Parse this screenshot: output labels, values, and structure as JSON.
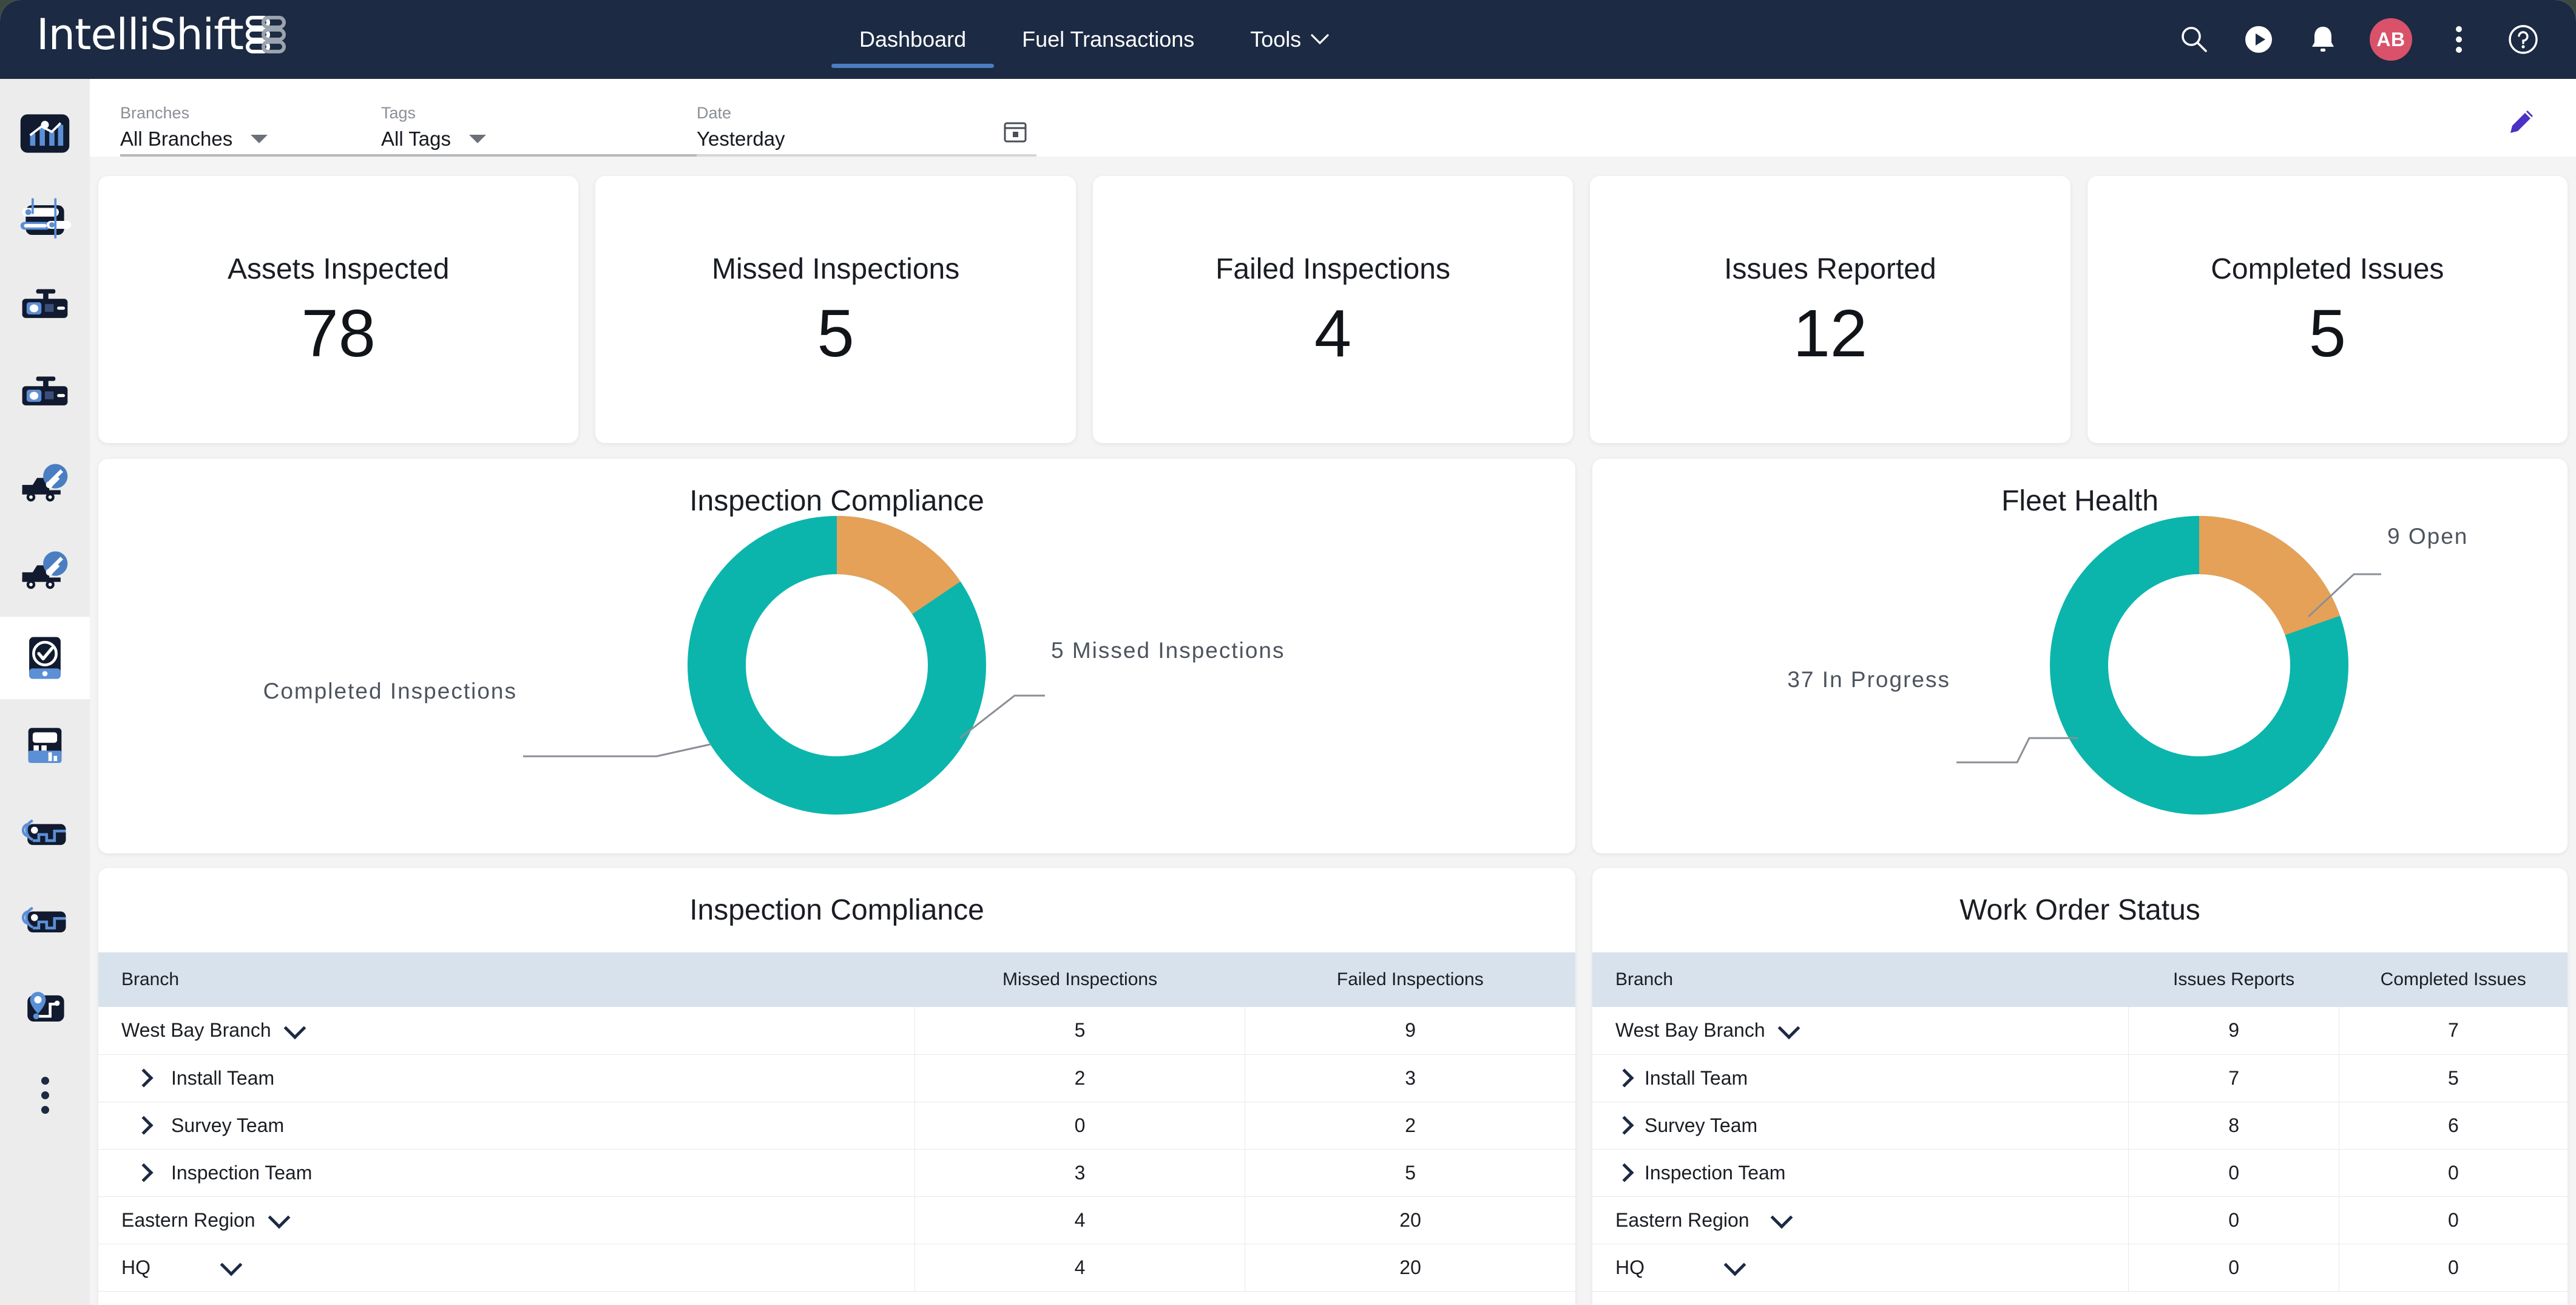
{
  "brand": {
    "name": "IntelliShift",
    "logo_icon": "intellishift-logo"
  },
  "topnav": {
    "items": [
      {
        "label": "Dashboard",
        "active": true
      },
      {
        "label": "Fuel Transactions",
        "active": false
      },
      {
        "label": "Tools",
        "active": false,
        "caret": true
      }
    ],
    "actions": [
      {
        "name": "search-icon"
      },
      {
        "name": "play-circle-icon"
      },
      {
        "name": "bell-icon"
      },
      {
        "name": "avatar",
        "initials": "AB"
      },
      {
        "name": "kebab-menu-icon"
      },
      {
        "name": "help-icon"
      }
    ],
    "avatar_initials": "AB",
    "avatar_color": "#d9526a",
    "active_underline_color": "#4a7ec0",
    "background": "#1c2a43"
  },
  "sidebar": {
    "items": [
      {
        "name": "sidebar-item-dashboard",
        "icon": "chart-dashboard-icon",
        "active": false
      },
      {
        "name": "sidebar-item-asset-tracking",
        "icon": "asset-tracking-icon",
        "active": false
      },
      {
        "name": "sidebar-item-dashcam",
        "icon": "dashcam-icon",
        "active": false
      },
      {
        "name": "sidebar-item-dashcam-2",
        "icon": "dashcam-icon",
        "active": false
      },
      {
        "name": "sidebar-item-maintenance",
        "icon": "truck-wrench-icon",
        "active": false
      },
      {
        "name": "sidebar-item-maintenance-2",
        "icon": "truck-wrench-icon",
        "active": false
      },
      {
        "name": "sidebar-item-inspections",
        "icon": "inspection-check-icon",
        "active": true
      },
      {
        "name": "sidebar-item-reports",
        "icon": "report-card-icon",
        "active": false
      },
      {
        "name": "sidebar-item-routes",
        "icon": "route-signal-icon",
        "active": false
      },
      {
        "name": "sidebar-item-routes-2",
        "icon": "route-signal-icon",
        "active": false
      },
      {
        "name": "sidebar-item-map",
        "icon": "map-pin-route-icon",
        "active": false
      },
      {
        "name": "sidebar-item-more",
        "icon": "kebab-menu-icon",
        "active": false
      }
    ]
  },
  "filters": {
    "branches": {
      "label": "Branches",
      "value": "All Branches"
    },
    "tags": {
      "label": "Tags",
      "value": "All Tags"
    },
    "date": {
      "label": "Date",
      "value": "Yesterday",
      "icon": "calendar-icon"
    },
    "edit": {
      "icon": "pencil-icon",
      "color": "#4b31c4"
    }
  },
  "kpis": [
    {
      "title": "Assets Inspected",
      "value": "78"
    },
    {
      "title": "Missed Inspections",
      "value": "5"
    },
    {
      "title": "Failed Inspections",
      "value": "4"
    },
    {
      "title": "Issues Reported",
      "value": "12"
    },
    {
      "title": "Completed Issues",
      "value": "5"
    }
  ],
  "chart_data": [
    {
      "type": "pie",
      "title": "Inspection Compliance",
      "variant": "donut",
      "labels": [
        "Completed Inspections",
        "5 Missed Inspections"
      ],
      "values": [
        73,
        13
      ],
      "colors": [
        "#0bb5ac",
        "#e5a158"
      ],
      "annotations": [
        {
          "text": "Completed Inspections",
          "side": "left"
        },
        {
          "text": "5 Missed Inspections",
          "side": "right"
        }
      ],
      "legend": "callout-labels"
    },
    {
      "type": "pie",
      "title": "Fleet Health",
      "variant": "donut",
      "labels": [
        "37 In Progress",
        "9 Open"
      ],
      "values": [
        37,
        9
      ],
      "colors": [
        "#0bb5ac",
        "#e5a158"
      ],
      "annotations": [
        {
          "text": "37 In Progress",
          "side": "left"
        },
        {
          "text": "9 Open",
          "side": "right"
        }
      ],
      "legend": "callout-labels"
    }
  ],
  "tables": {
    "inspection_compliance": {
      "title": "Inspection Compliance",
      "columns": [
        "Branch",
        "Missed Inspections",
        "Failed Inspections"
      ],
      "rows": [
        {
          "branch": "West Bay Branch",
          "level": 0,
          "toggle": "down",
          "missed": "5",
          "failed": "9"
        },
        {
          "branch": "Install Team",
          "level": 1,
          "toggle": "right",
          "missed": "2",
          "failed": "3"
        },
        {
          "branch": "Survey Team",
          "level": 1,
          "toggle": "right",
          "missed": "0",
          "failed": "2"
        },
        {
          "branch": "Inspection Team",
          "level": 1,
          "toggle": "right",
          "missed": "3",
          "failed": "5"
        },
        {
          "branch": "Eastern Region",
          "level": 0,
          "toggle": "down",
          "missed": "4",
          "failed": "20"
        },
        {
          "branch": "HQ",
          "level": 0,
          "toggle": "down",
          "missed": "4",
          "failed": "20"
        }
      ]
    },
    "work_order_status": {
      "title": "Work Order Status",
      "columns": [
        "Branch",
        "Issues Reports",
        "Completed Issues"
      ],
      "rows": [
        {
          "branch": "West Bay Branch",
          "level": 0,
          "toggle": "down",
          "reports": "9",
          "completed": "7"
        },
        {
          "branch": "Install Team",
          "level": 1,
          "toggle": "right",
          "reports": "7",
          "completed": "5"
        },
        {
          "branch": "Survey Team",
          "level": 1,
          "toggle": "right",
          "reports": "8",
          "completed": "6"
        },
        {
          "branch": "Inspection Team",
          "level": 1,
          "toggle": "right",
          "reports": "0",
          "completed": "0"
        },
        {
          "branch": "Eastern Region",
          "level": 0,
          "toggle": "down",
          "reports": "0",
          "completed": "0"
        },
        {
          "branch": "HQ",
          "level": 0,
          "toggle": "down",
          "reports": "0",
          "completed": "0"
        }
      ]
    }
  },
  "theme": {
    "teal": "#0bb5ac",
    "orange": "#e5a158",
    "header_bg": "#1c2a43",
    "table_header_bg": "#d8e2ed",
    "accent_blue": "#4a7ec0"
  }
}
